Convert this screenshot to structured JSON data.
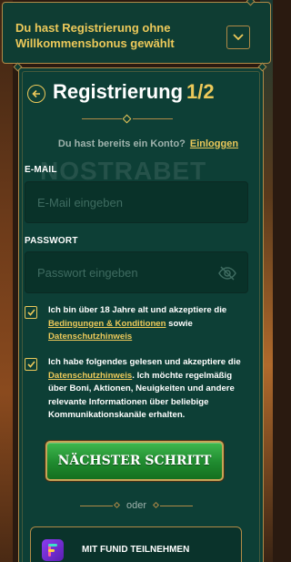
{
  "colors": {
    "panel": "#0d3f36",
    "gold": "#ecc95a",
    "border": "#b08a47",
    "button_green": "#1f8a2f"
  },
  "banner": {
    "line1": "Du hast Registrierung ohne",
    "line2": "Willkommensbonus gewählt",
    "toggle_icon": "chevron-down-icon"
  },
  "header": {
    "back_icon": "arrow-left-icon",
    "title": "Registrierung",
    "step": "1/2"
  },
  "login": {
    "prompt": "Du hast bereits ein Konto?",
    "link": "Einloggen"
  },
  "watermark": "NOSTRABET",
  "email": {
    "label": "E-MAIL",
    "placeholder": "E-Mail eingeben",
    "value": ""
  },
  "password": {
    "label": "PASSWORT",
    "placeholder": "Passwort eingeben",
    "value": "",
    "toggle_icon": "eye-off-icon"
  },
  "consent_age": {
    "checked": true,
    "text_before": "Ich bin über 18 Jahre alt und akzeptiere die ",
    "link1": "Bedingungen & Konditionen",
    "text_mid": " sowie ",
    "link2": "Datenschutzhinweis"
  },
  "consent_marketing": {
    "checked": true,
    "text_before": "Ich habe folgendes gelesen und akzeptiere die ",
    "link": "Datenschutzhinweis",
    "text_after": ". Ich möchte regelmäßig über Boni, Aktionen, Neuigkeiten und andere relevante Informationen über beliebige Kommunikationskanäle erhalten."
  },
  "next_button": {
    "label": "NÄCHSTER SCHRITT"
  },
  "divider": {
    "label": "oder"
  },
  "funid": {
    "label": "MIT FUNID TEILNEHMEN",
    "icon": "funid-logo-icon"
  }
}
